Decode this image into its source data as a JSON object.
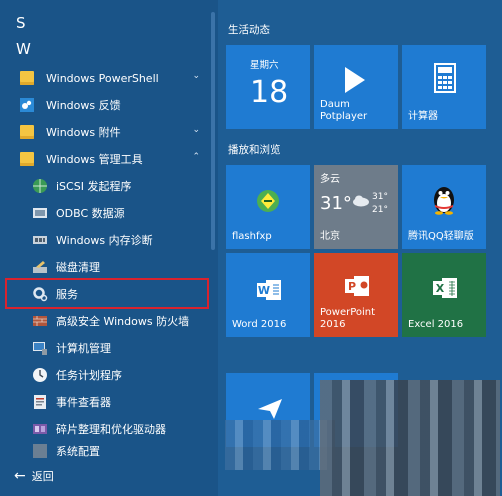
{
  "start_menu": {
    "section_letters": [
      "S",
      "W"
    ],
    "apps": [
      {
        "label": "Windows PowerShell",
        "chevron": "⌄",
        "icon": "folder-icon"
      },
      {
        "label": "Windows 反馈",
        "icon": "feedback-icon"
      },
      {
        "label": "Windows 附件",
        "chevron": "⌄",
        "icon": "folder-icon"
      },
      {
        "label": "Windows 管理工具",
        "chevron": "⌃",
        "icon": "folder-icon"
      },
      {
        "label": "iSCSI 发起程序",
        "icon": "globe-icon"
      },
      {
        "label": "ODBC 数据源",
        "icon": "database-icon"
      },
      {
        "label": "Windows 内存诊断",
        "icon": "memory-chip-icon"
      },
      {
        "label": "磁盘清理",
        "icon": "disk-cleanup-icon"
      },
      {
        "label": "服务",
        "icon": "services-gear-icon"
      },
      {
        "label": "高级安全 Windows 防火墙",
        "icon": "firewall-icon"
      },
      {
        "label": "计算机管理",
        "icon": "computer-management-icon"
      },
      {
        "label": "任务计划程序",
        "icon": "task-scheduler-icon"
      },
      {
        "label": "事件查看器",
        "icon": "event-viewer-icon"
      },
      {
        "label": "碎片整理和优化驱动器",
        "icon": "defrag-icon"
      },
      {
        "label": "系统配置",
        "icon": "system-config-icon"
      }
    ],
    "back_label": "返回"
  },
  "tiles": {
    "group1_title": "生活动态",
    "group2_title": "播放和浏览",
    "calendar": {
      "weekday": "星期六",
      "day": "18"
    },
    "daum": {
      "label": "Daum\nPotplayer"
    },
    "calculator": {
      "label": "计算器"
    },
    "flashfxp": {
      "label": "flashfxp"
    },
    "weather": {
      "condition": "多云",
      "temp": "31°",
      "high": "31°",
      "low": "21°",
      "city": "北京"
    },
    "qq": {
      "label": "腾讯QQ轻聊版"
    },
    "word": {
      "label": "Word 2016"
    },
    "powerpoint": {
      "label": "PowerPoint\n2016"
    },
    "excel": {
      "label": "Excel 2016"
    }
  },
  "colors": {
    "tile_blue": "#1f7bd2",
    "powerpoint_orange": "#d24726",
    "excel_green": "#207245",
    "selection_red": "#d9232e",
    "folder_yellow": "#f4c542"
  }
}
